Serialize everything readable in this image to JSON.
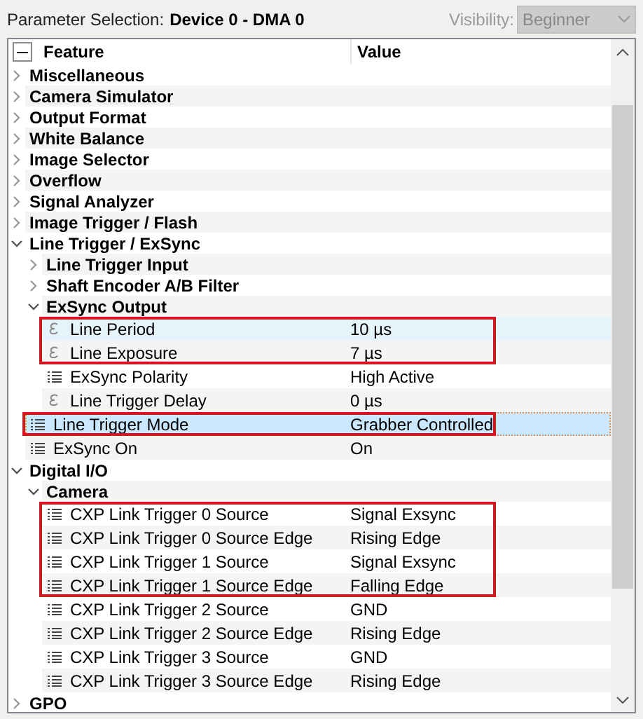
{
  "header": {
    "label": "Parameter Selection:",
    "device": "Device 0 - DMA 0",
    "visibility_label": "Visibility:",
    "visibility_value": "Beginner",
    "visibility_disabled": true
  },
  "columns": [
    "Feature",
    "Value"
  ],
  "tree": [
    {
      "kind": "group",
      "label": "Miscellaneous",
      "expanded": false,
      "selected": false,
      "hovered": false,
      "highlighted": false
    },
    {
      "kind": "group",
      "label": "Camera Simulator",
      "expanded": false,
      "selected": false,
      "hovered": false,
      "highlighted": false
    },
    {
      "kind": "group",
      "label": "Output Format",
      "expanded": false,
      "selected": false,
      "hovered": false,
      "highlighted": false
    },
    {
      "kind": "group",
      "label": "White Balance",
      "expanded": false,
      "selected": false,
      "hovered": false,
      "highlighted": false
    },
    {
      "kind": "group",
      "label": "Image Selector",
      "expanded": false,
      "selected": false,
      "hovered": false,
      "highlighted": false
    },
    {
      "kind": "group",
      "label": "Overflow",
      "expanded": false,
      "selected": false,
      "hovered": false,
      "highlighted": false
    },
    {
      "kind": "group",
      "label": "Signal Analyzer",
      "expanded": false,
      "selected": false,
      "hovered": false,
      "highlighted": false
    },
    {
      "kind": "group",
      "label": "Image Trigger / Flash",
      "expanded": false,
      "selected": false,
      "hovered": false,
      "highlighted": false
    },
    {
      "kind": "group",
      "label": "Line Trigger / ExSync",
      "expanded": true,
      "selected": false,
      "hovered": false,
      "highlighted": false,
      "children": [
        {
          "kind": "group",
          "label": "Line Trigger Input",
          "expanded": false,
          "selected": false,
          "hovered": false,
          "highlighted": false
        },
        {
          "kind": "group",
          "label": "Shaft Encoder A/B Filter",
          "expanded": false,
          "selected": false,
          "hovered": false,
          "highlighted": false
        },
        {
          "kind": "group",
          "label": "ExSync Output",
          "expanded": true,
          "selected": false,
          "hovered": false,
          "highlighted": false,
          "children": [
            {
              "kind": "float",
              "label": "Line Period",
              "value": "10 µs",
              "selected": false,
              "hovered": true,
              "highlighted": true
            },
            {
              "kind": "float",
              "label": "Line Exposure",
              "value": "7 µs",
              "selected": false,
              "hovered": false,
              "highlighted": true
            },
            {
              "kind": "enum",
              "label": "ExSync Polarity",
              "value": "High Active",
              "selected": false,
              "hovered": false,
              "highlighted": false
            },
            {
              "kind": "float",
              "label": "Line Trigger Delay",
              "value": "0 µs",
              "selected": false,
              "hovered": false,
              "highlighted": false
            }
          ]
        },
        {
          "kind": "enum",
          "label": "Line Trigger Mode",
          "value": "Grabber Controlled",
          "selected": true,
          "hovered": false,
          "highlighted": true
        },
        {
          "kind": "enum",
          "label": "ExSync On",
          "value": "On",
          "selected": false,
          "hovered": false,
          "highlighted": false
        }
      ]
    },
    {
      "kind": "group",
      "label": "Digital I/O",
      "expanded": true,
      "selected": false,
      "hovered": false,
      "highlighted": false,
      "children": [
        {
          "kind": "group",
          "label": "Camera",
          "expanded": true,
          "selected": false,
          "hovered": false,
          "highlighted": false,
          "children": [
            {
              "kind": "enum",
              "label": "CXP Link Trigger 0 Source",
              "value": "Signal Exsync",
              "selected": false,
              "hovered": false,
              "highlighted": true
            },
            {
              "kind": "enum",
              "label": "CXP Link Trigger 0 Source Edge",
              "value": "Rising Edge",
              "selected": false,
              "hovered": false,
              "highlighted": true
            },
            {
              "kind": "enum",
              "label": "CXP Link Trigger 1 Source",
              "value": "Signal Exsync",
              "selected": false,
              "hovered": false,
              "highlighted": true
            },
            {
              "kind": "enum",
              "label": "CXP Link Trigger 1 Source Edge",
              "value": "Falling Edge",
              "selected": false,
              "hovered": false,
              "highlighted": true
            },
            {
              "kind": "enum",
              "label": "CXP Link Trigger 2 Source",
              "value": "GND",
              "selected": false,
              "hovered": false,
              "highlighted": false
            },
            {
              "kind": "enum",
              "label": "CXP Link Trigger 2 Source Edge",
              "value": "Rising Edge",
              "selected": false,
              "hovered": false,
              "highlighted": false
            },
            {
              "kind": "enum",
              "label": "CXP Link Trigger 3 Source",
              "value": "GND",
              "selected": false,
              "hovered": false,
              "highlighted": false
            },
            {
              "kind": "enum",
              "label": "CXP Link Trigger 3 Source Edge",
              "value": "Rising Edge",
              "selected": false,
              "hovered": false,
              "highlighted": false
            }
          ]
        }
      ]
    },
    {
      "kind": "group",
      "label": "GPO",
      "expanded": false,
      "selected": false,
      "hovered": false,
      "highlighted": false
    }
  ]
}
